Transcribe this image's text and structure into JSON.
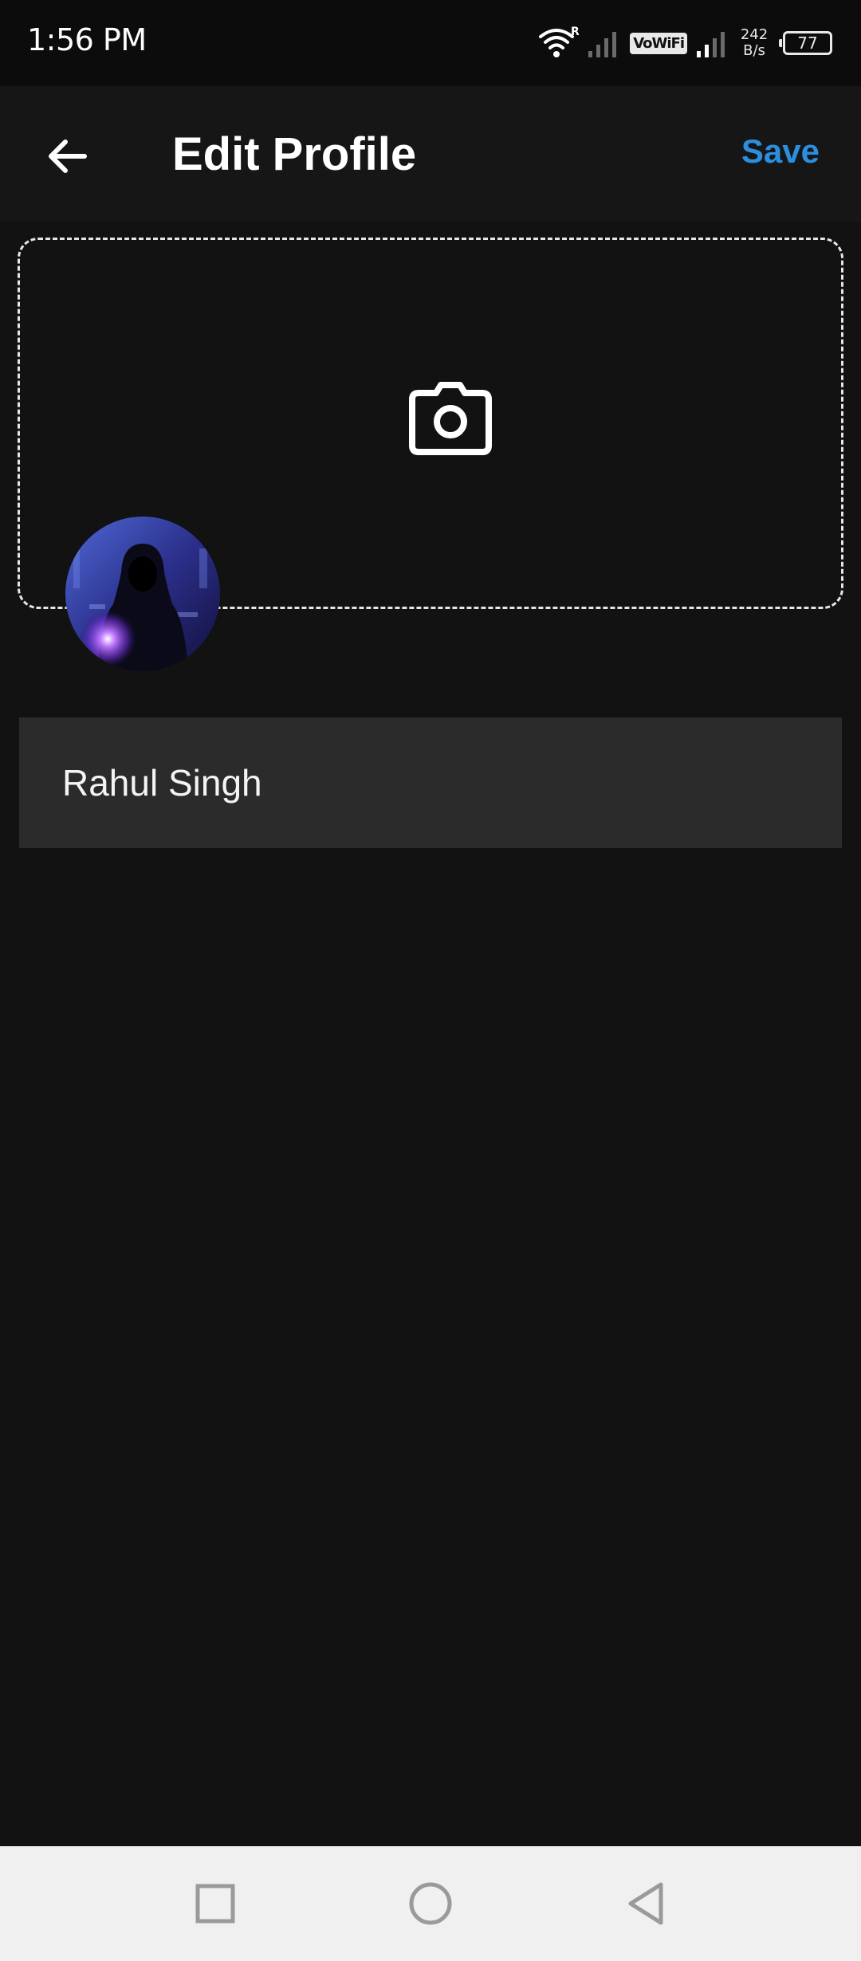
{
  "status_bar": {
    "time": "1:56 PM",
    "roaming_indicator": "R",
    "vowifi_label": "VoWiFi",
    "net_speed_value": "242",
    "net_speed_unit": "B/s",
    "battery_level": "77",
    "icons": [
      "wifi-icon",
      "signal-icon",
      "vowifi-icon",
      "signal-icon",
      "battery-icon"
    ]
  },
  "app_bar": {
    "back_icon": "arrow-left-icon",
    "title": "Edit Profile",
    "save_label": "Save",
    "accent_color": "#2b8fe0"
  },
  "cover": {
    "icon": "camera-icon"
  },
  "profile": {
    "name": "Rahul Singh"
  },
  "nav_bar": {
    "icons": [
      "recents-square-icon",
      "home-circle-icon",
      "back-triangle-icon"
    ]
  }
}
